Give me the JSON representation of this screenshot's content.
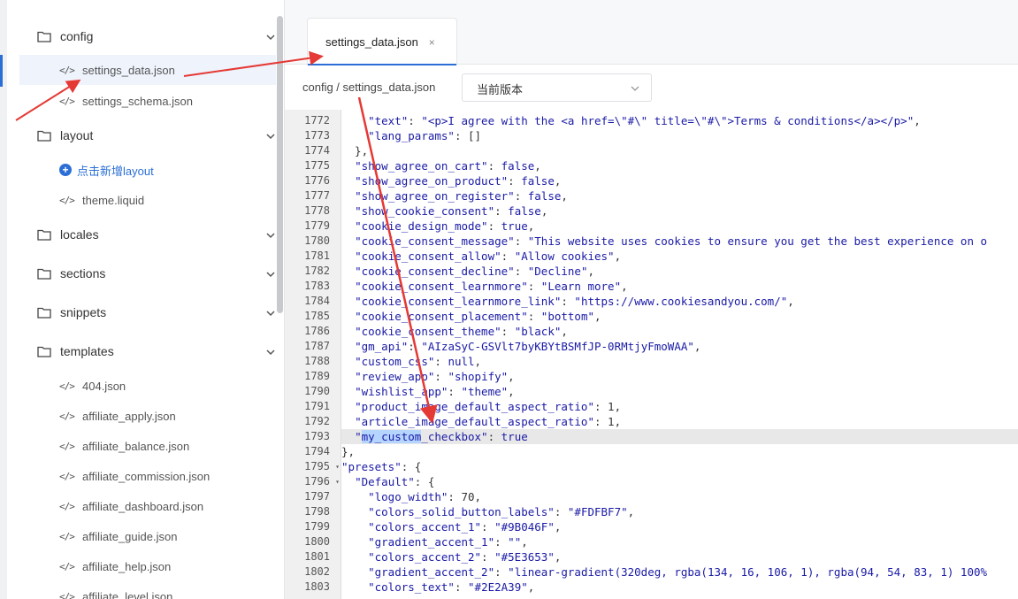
{
  "sidebar": {
    "items": [
      {
        "type": "folder",
        "label": "config",
        "expanded": true
      },
      {
        "type": "file",
        "label": "settings_data.json",
        "active": true
      },
      {
        "type": "file",
        "label": "settings_schema.json"
      },
      {
        "type": "folder",
        "label": "layout",
        "expanded": true
      },
      {
        "type": "add",
        "label": "点击新增layout"
      },
      {
        "type": "file",
        "label": "theme.liquid"
      },
      {
        "type": "folder",
        "label": "locales"
      },
      {
        "type": "folder",
        "label": "sections"
      },
      {
        "type": "folder",
        "label": "snippets"
      },
      {
        "type": "folder",
        "label": "templates",
        "expanded": true
      },
      {
        "type": "file",
        "label": "404.json"
      },
      {
        "type": "file",
        "label": "affiliate_apply.json"
      },
      {
        "type": "file",
        "label": "affiliate_balance.json"
      },
      {
        "type": "file",
        "label": "affiliate_commission.json"
      },
      {
        "type": "file",
        "label": "affiliate_dashboard.json"
      },
      {
        "type": "file",
        "label": "affiliate_guide.json"
      },
      {
        "type": "file",
        "label": "affiliate_help.json"
      },
      {
        "type": "file",
        "label": "affiliate_level.json"
      }
    ]
  },
  "tab": {
    "label": "settings_data.json",
    "close": "×"
  },
  "path": {
    "text": "config / settings_data.json",
    "version_label": "当前版本"
  },
  "editor": {
    "lines": [
      {
        "n": "1772",
        "html": "    <span class=\"s\">\"text\"</span>: <span class=\"s\">\"&lt;p&gt;I agree with the &lt;a href=\\\"#\\\" title=\\\"#\\\"&gt;Terms &amp; conditions&lt;/a&gt;&lt;/p&gt;\"</span>,"
      },
      {
        "n": "1773",
        "html": "    <span class=\"s\">\"lang_params\"</span>: []"
      },
      {
        "n": "1774",
        "html": "  },"
      },
      {
        "n": "1775",
        "html": "  <span class=\"s\">\"show_agree_on_cart\"</span>: <span class=\"b\">false</span>,"
      },
      {
        "n": "1776",
        "html": "  <span class=\"s\">\"show_agree_on_product\"</span>: <span class=\"b\">false</span>,"
      },
      {
        "n": "1777",
        "html": "  <span class=\"s\">\"show_agree_on_register\"</span>: <span class=\"b\">false</span>,"
      },
      {
        "n": "1778",
        "html": "  <span class=\"s\">\"show_cookie_consent\"</span>: <span class=\"b\">false</span>,"
      },
      {
        "n": "1779",
        "html": "  <span class=\"s\">\"cookie_design_mode\"</span>: <span class=\"b\">true</span>,"
      },
      {
        "n": "1780",
        "html": "  <span class=\"s\">\"cookie_consent_message\"</span>: <span class=\"s\">\"This website uses cookies to ensure you get the best experience on o</span>"
      },
      {
        "n": "1781",
        "html": "  <span class=\"s\">\"cookie_consent_allow\"</span>: <span class=\"s\">\"Allow cookies\"</span>,"
      },
      {
        "n": "1782",
        "html": "  <span class=\"s\">\"cookie_consent_decline\"</span>: <span class=\"s\">\"Decline\"</span>,"
      },
      {
        "n": "1783",
        "html": "  <span class=\"s\">\"cookie_consent_learnmore\"</span>: <span class=\"s\">\"Learn more\"</span>,"
      },
      {
        "n": "1784",
        "html": "  <span class=\"s\">\"cookie_consent_learnmore_link\"</span>: <span class=\"s\">\"https://www.cookiesandyou.com/\"</span>,"
      },
      {
        "n": "1785",
        "html": "  <span class=\"s\">\"cookie_consent_placement\"</span>: <span class=\"s\">\"bottom\"</span>,"
      },
      {
        "n": "1786",
        "html": "  <span class=\"s\">\"cookie_consent_theme\"</span>: <span class=\"s\">\"black\"</span>,"
      },
      {
        "n": "1787",
        "html": "  <span class=\"s\">\"gm_api\"</span>: <span class=\"s\">\"AIzaSyC-GSVlt7byKBYtBSMfJP-0RMtjyFmoWAA\"</span>,"
      },
      {
        "n": "1788",
        "html": "  <span class=\"s\">\"custom_css\"</span>: <span class=\"b\">null</span>,"
      },
      {
        "n": "1789",
        "html": "  <span class=\"s\">\"review_app\"</span>: <span class=\"s\">\"shopify\"</span>,"
      },
      {
        "n": "1790",
        "html": "  <span class=\"s\">\"wishlist_app\"</span>: <span class=\"s\">\"theme\"</span>,"
      },
      {
        "n": "1791",
        "html": "  <span class=\"s\">\"product_image_default_aspect_ratio\"</span>: 1,"
      },
      {
        "n": "1792",
        "html": "  <span class=\"s\">\"article_image_default_aspect_ratio\"</span>: 1,"
      },
      {
        "n": "1793",
        "html": "  <span class=\"s\">\"<span class=\"sel-txt\">my_custom</span>_checkbox\"</span>: <span class=\"b\">true</span>",
        "hl": true
      },
      {
        "n": "1794",
        "html": "},"
      },
      {
        "n": "1795",
        "html": "<span class=\"s\">\"presets\"</span>: {",
        "fold": true
      },
      {
        "n": "1796",
        "html": "  <span class=\"s\">\"Default\"</span>: {",
        "fold": true
      },
      {
        "n": "1797",
        "html": "    <span class=\"s\">\"logo_width\"</span>: 70,"
      },
      {
        "n": "1798",
        "html": "    <span class=\"s\">\"colors_solid_button_labels\"</span>: <span class=\"s\">\"#FDFBF7\"</span>,"
      },
      {
        "n": "1799",
        "html": "    <span class=\"s\">\"colors_accent_1\"</span>: <span class=\"s\">\"#9B046F\"</span>,"
      },
      {
        "n": "1800",
        "html": "    <span class=\"s\">\"gradient_accent_1\"</span>: <span class=\"s\">\"\"</span>,"
      },
      {
        "n": "1801",
        "html": "    <span class=\"s\">\"colors_accent_2\"</span>: <span class=\"s\">\"#5E3653\"</span>,"
      },
      {
        "n": "1802",
        "html": "    <span class=\"s\">\"gradient_accent_2\"</span>: <span class=\"s\">\"linear-gradient(320deg, rgba(134, 16, 106, 1), rgba(94, 54, 83, 1) 100%</span>"
      },
      {
        "n": "1803",
        "html": "    <span class=\"s\">\"colors_text\"</span>: <span class=\"s\">\"#2E2A39\"</span>,"
      }
    ]
  },
  "colors": {
    "accent": "#2b6fd6",
    "arrow": "#e53935"
  }
}
